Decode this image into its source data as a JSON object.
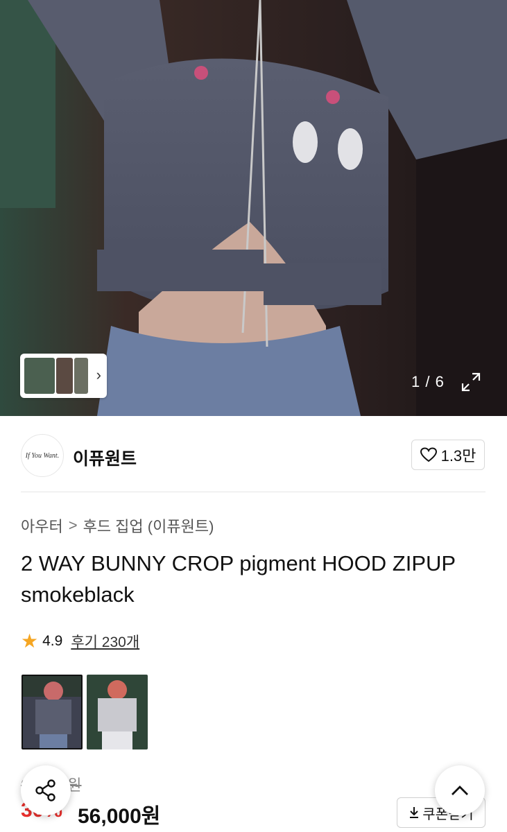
{
  "gallery": {
    "counter": "1 / 6",
    "expand_icon": "expand-icon",
    "chevron_icon": "chevron-right-icon"
  },
  "seller": {
    "logo_text": "If You Want.",
    "name": "이퓨원트",
    "likes": "1.3만"
  },
  "breadcrumb": {
    "items": [
      "아우터",
      "후드 집업 (이퓨원트)"
    ],
    "separator": ">"
  },
  "product": {
    "title": "2 WAY BUNNY CROP pigment HOOD ZIPUP smokeblack",
    "rating": "4.9",
    "reviews": "후기 230개"
  },
  "price": {
    "original": "80,000원",
    "discount": "30%",
    "sale": "56,000원",
    "coupon_label": "쿠폰받기"
  },
  "colors": {
    "accent_red": "#e8302d",
    "star": "#f5a623"
  }
}
